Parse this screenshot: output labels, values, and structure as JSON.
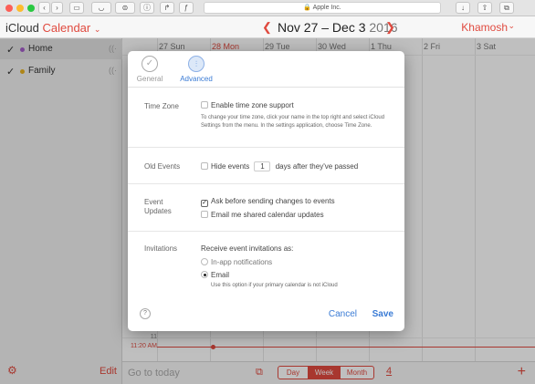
{
  "browser": {
    "url": "Apple Inc.",
    "new_tab": "+"
  },
  "header": {
    "brand_icloud": "iCloud",
    "brand_calendar": "Calendar",
    "prev": "❮",
    "next": "❯",
    "range": "Nov 27 – Dec 3",
    "year": "2016",
    "user": "Khamosh"
  },
  "sidebar": {
    "items": [
      {
        "label": "Home",
        "color": "#a35cc9"
      },
      {
        "label": "Family",
        "color": "#e9b21f"
      }
    ],
    "edit": "Edit"
  },
  "calendar": {
    "days": [
      "27 Sun",
      "28 Mon",
      "29 Tue",
      "30 Wed",
      "1 Thu",
      "2 Fri",
      "3 Sat"
    ],
    "hour_label": "11",
    "now_label": "11:20 AM",
    "accent": "#e04a3f"
  },
  "bottombar": {
    "goto_today": "Go to today",
    "views": [
      "Day",
      "Week",
      "Month"
    ],
    "active_view": "Week",
    "badge": "4"
  },
  "dialog": {
    "tabs": {
      "general": "General",
      "advanced": "Advanced"
    },
    "timezone": {
      "label": "Time Zone",
      "option": "Enable time zone support",
      "help": "To change your time zone, click your name in the top right and select iCloud Settings from the menu. In the settings application, choose Time Zone."
    },
    "old_events": {
      "label": "Old Events",
      "prefix": "Hide events",
      "days": "1",
      "suffix": "days after they've passed"
    },
    "event_updates": {
      "label": "Event Updates",
      "ask": "Ask before sending changes to events",
      "email_shared": "Email me shared calendar updates"
    },
    "invitations": {
      "label": "Invitations",
      "heading": "Receive event invitations as:",
      "in_app": "In-app notifications",
      "email": "Email",
      "email_help": "Use this option if your primary calendar is not iCloud"
    },
    "help_button": "?",
    "cancel": "Cancel",
    "save": "Save"
  }
}
